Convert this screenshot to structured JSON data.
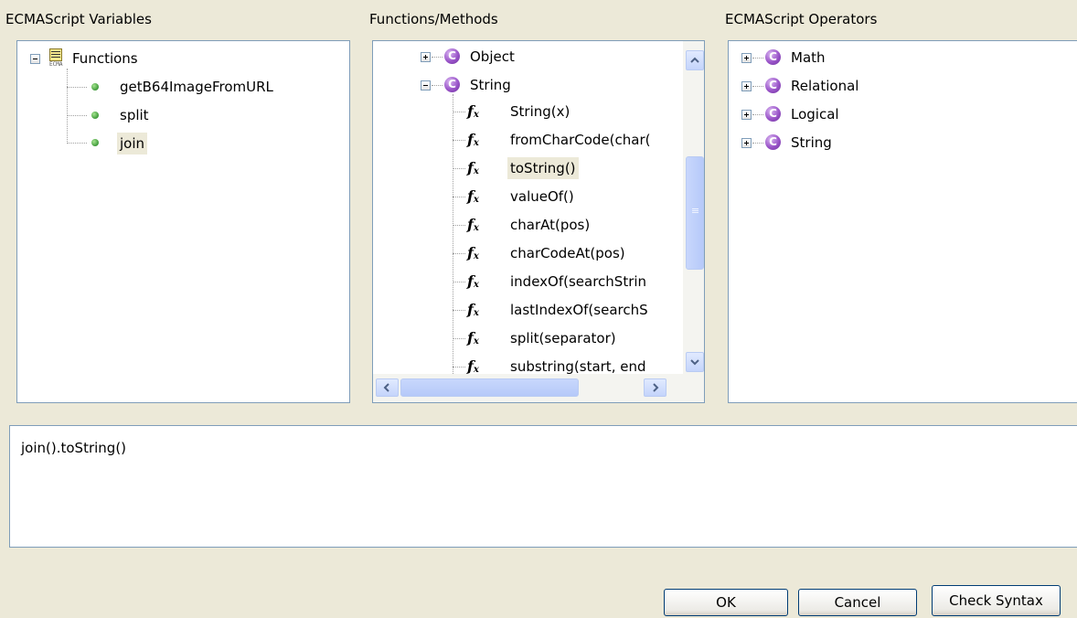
{
  "left_panel": {
    "title": "ECMAScript Variables",
    "root_icon_text": "ECMA",
    "root_label": "Functions",
    "items": [
      {
        "label": "getB64ImageFromURL"
      },
      {
        "label": "split"
      },
      {
        "label": "join"
      }
    ]
  },
  "middle_panel": {
    "title": "Functions/Methods",
    "classes": [
      {
        "label": "Object",
        "expanded": false
      },
      {
        "label": "String",
        "expanded": true
      }
    ],
    "methods": [
      {
        "label": "String(x)"
      },
      {
        "label": "fromCharCode(char("
      },
      {
        "label": "toString()"
      },
      {
        "label": "valueOf()"
      },
      {
        "label": "charAt(pos)"
      },
      {
        "label": "charCodeAt(pos)"
      },
      {
        "label": "indexOf(searchStrin"
      },
      {
        "label": "lastIndexOf(searchS"
      },
      {
        "label": "split(separator)"
      },
      {
        "label": "substring(start, end"
      }
    ],
    "class_icon_glyph": "C",
    "fx_glyph": "f",
    "fx_sub": "x"
  },
  "right_panel": {
    "title": "ECMAScript Operators",
    "items": [
      {
        "label": "Math"
      },
      {
        "label": "Relational"
      },
      {
        "label": "Logical"
      },
      {
        "label": "String"
      }
    ]
  },
  "expression": {
    "value": "join().toString()"
  },
  "buttons": {
    "ok": "OK",
    "cancel": "Cancel",
    "check_syntax": "Check Syntax"
  },
  "colors": {
    "background": "#ece9d8",
    "border": "#7f9db9",
    "selection": "#ece9d8",
    "class_icon": "#9a55c9",
    "leaf_dot": "#3f9b3a"
  }
}
